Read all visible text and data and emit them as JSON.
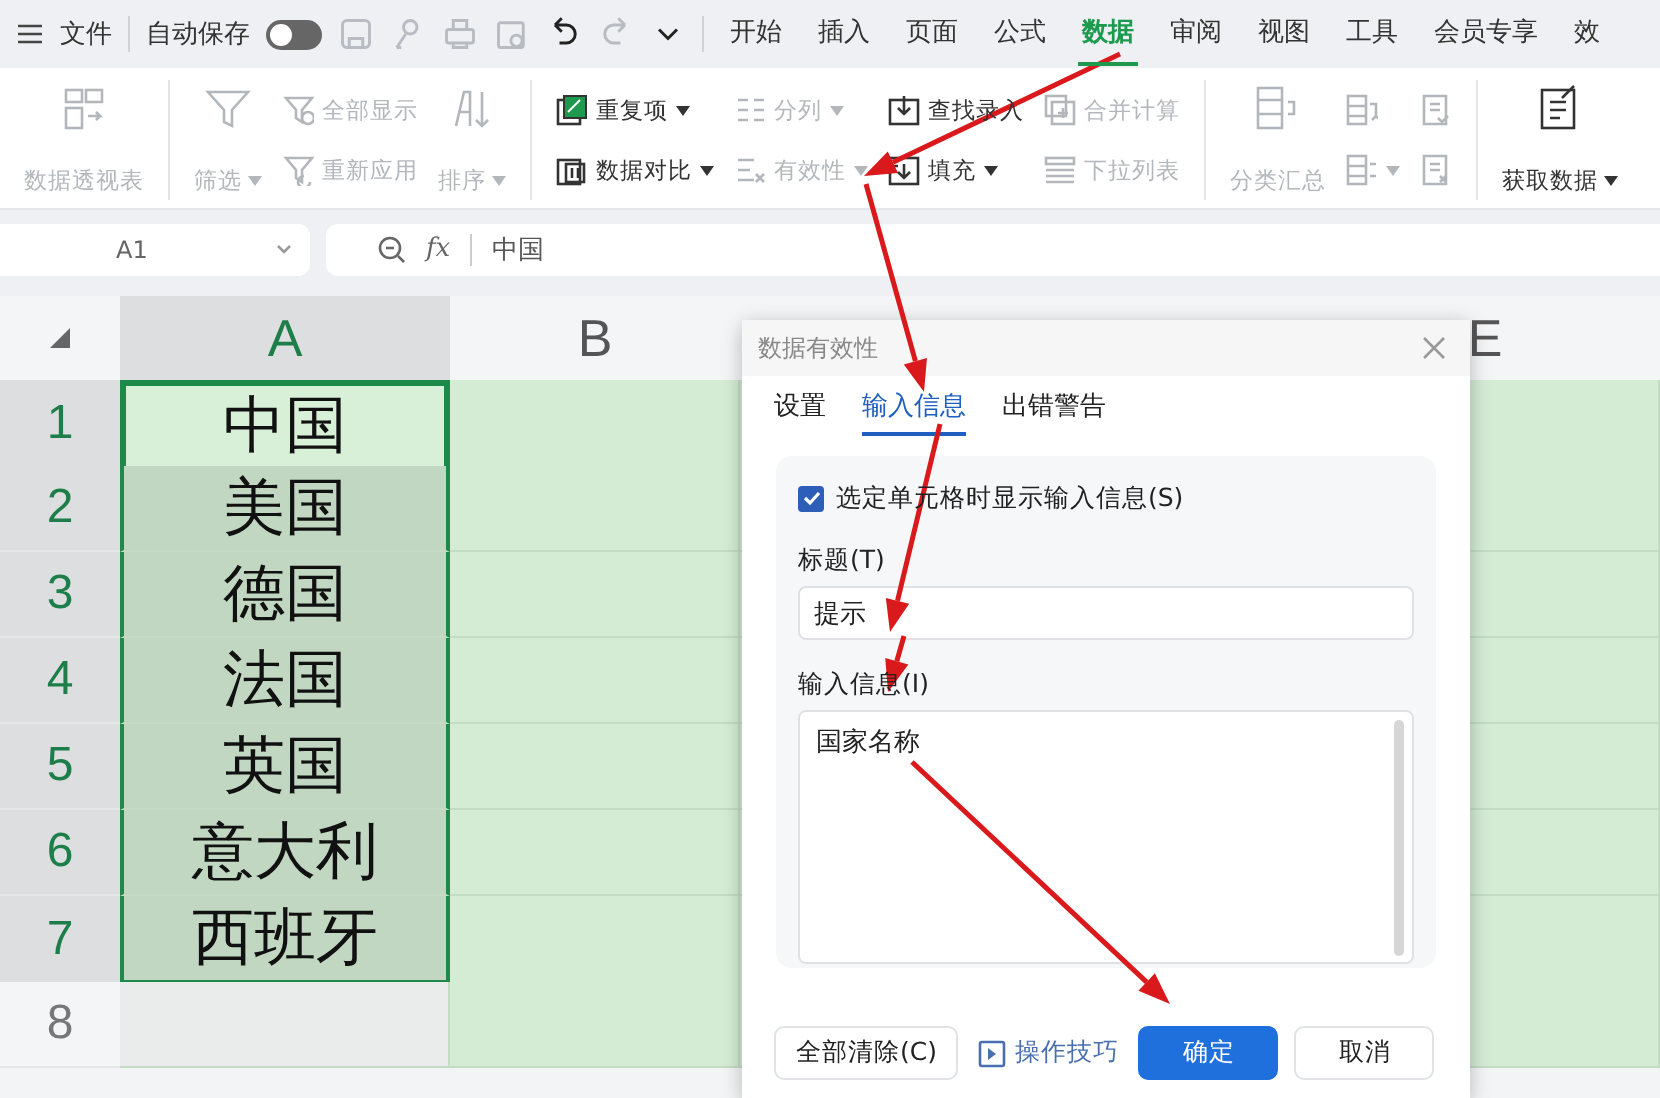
{
  "topbar": {
    "file_label": "文件",
    "autosave": {
      "label": "自动保存",
      "on": false
    },
    "quick_tools": [
      {
        "disabled": true
      },
      {
        "disabled": true
      },
      {
        "disabled": true
      },
      {
        "disabled": true
      },
      {
        "disabled": false
      },
      {
        "disabled": true
      },
      {
        "disabled": false
      }
    ],
    "tabs": [
      {
        "label": "开始",
        "selected": false
      },
      {
        "label": "插入",
        "selected": false
      },
      {
        "label": "页面",
        "selected": false
      },
      {
        "label": "公式",
        "selected": false
      },
      {
        "label": "数据",
        "selected": true
      },
      {
        "label": "审阅",
        "selected": false
      },
      {
        "label": "视图",
        "selected": false
      },
      {
        "label": "工具",
        "selected": false
      },
      {
        "label": "会员专享",
        "selected": false
      },
      {
        "label": "效",
        "selected": false
      }
    ]
  },
  "ribbon": {
    "groups": [
      [
        {
          "kind": "large",
          "label": "数据透视表",
          "disabled": true,
          "dropdown": false
        }
      ],
      [
        {
          "kind": "large",
          "label": "筛选",
          "disabled": true,
          "dropdown": true
        },
        {
          "kind": "stack",
          "items": [
            {
              "label": "全部显示",
              "disabled": true,
              "dropdown": false
            },
            {
              "label": "重新应用",
              "disabled": true,
              "dropdown": false
            }
          ]
        },
        {
          "kind": "large",
          "label": "排序",
          "disabled": true,
          "dropdown": true
        }
      ],
      [
        {
          "kind": "stack",
          "items": [
            {
              "label": "重复项",
              "disabled": false,
              "dropdown": true
            },
            {
              "label": "数据对比",
              "disabled": false,
              "dropdown": true
            }
          ]
        },
        {
          "kind": "stack",
          "items": [
            {
              "label": "分列",
              "disabled": true,
              "dropdown": true
            },
            {
              "label": "有效性",
              "disabled": true,
              "dropdown": true
            }
          ]
        },
        {
          "kind": "stack",
          "items": [
            {
              "label": "查找录入",
              "disabled": false,
              "dropdown": false
            },
            {
              "label": "填充",
              "disabled": false,
              "dropdown": true
            }
          ]
        },
        {
          "kind": "stack",
          "items": [
            {
              "label": "合并计算",
              "disabled": true,
              "dropdown": false
            },
            {
              "label": "下拉列表",
              "disabled": true,
              "dropdown": false
            }
          ]
        }
      ],
      [
        {
          "kind": "large",
          "label": "分类汇总",
          "disabled": true,
          "dropdown": false
        },
        {
          "kind": "stack",
          "items": [
            {
              "disabled": true,
              "dropdown": false
            },
            {
              "disabled": true,
              "dropdown": true
            }
          ]
        },
        {
          "kind": "stack",
          "items": [
            {
              "disabled": true,
              "dropdown": false
            },
            {
              "disabled": true,
              "dropdown": false
            }
          ]
        }
      ],
      [
        {
          "kind": "large",
          "label": "获取数据",
          "disabled": false,
          "dropdown": true
        }
      ]
    ]
  },
  "formula_bar": {
    "cell_ref": "A1",
    "fx": "fx",
    "value": "中国"
  },
  "sheet": {
    "columns": [
      {
        "label": "A",
        "selected": true
      },
      {
        "label": "B",
        "selected": false
      },
      {
        "label": "E",
        "selected": false
      }
    ],
    "rows": [
      {
        "label": "1",
        "selected": true,
        "active": true,
        "cells": [
          "中国"
        ]
      },
      {
        "label": "2",
        "selected": true,
        "active": false,
        "cells": [
          "美国"
        ]
      },
      {
        "label": "3",
        "selected": true,
        "active": false,
        "cells": [
          "德国"
        ]
      },
      {
        "label": "4",
        "selected": true,
        "active": false,
        "cells": [
          "法国"
        ]
      },
      {
        "label": "5",
        "selected": true,
        "active": false,
        "cells": [
          "英国"
        ]
      },
      {
        "label": "6",
        "selected": true,
        "active": false,
        "cells": [
          "意大利"
        ]
      },
      {
        "label": "7",
        "selected": true,
        "active": false,
        "cells": [
          "西班牙"
        ]
      },
      {
        "label": "8",
        "selected": false,
        "active": false,
        "cells": []
      }
    ]
  },
  "dialog": {
    "title": "数据有效性",
    "tabs": [
      {
        "label": "设置",
        "selected": false
      },
      {
        "label": "输入信息",
        "selected": true
      },
      {
        "label": "出错警告",
        "selected": false
      }
    ],
    "show_input_message": {
      "label": "选定单元格时显示输入信息(S)",
      "checked": true
    },
    "title_field": {
      "label": "标题(T)",
      "value": "提示"
    },
    "message_field": {
      "label": "输入信息(I)",
      "value": "国家名称"
    },
    "buttons": {
      "clear": "全部清除(C)",
      "tips": "操作技巧",
      "ok": "确定",
      "cancel": "取消"
    }
  }
}
